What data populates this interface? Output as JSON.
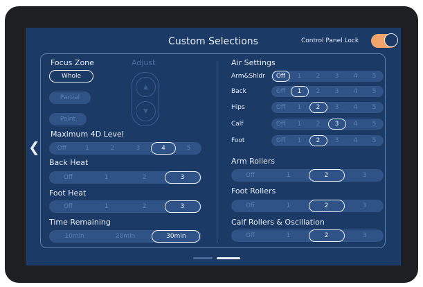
{
  "header": {
    "title": "Custom Selections",
    "lock_label": "Control Panel Lock",
    "lock_on": true
  },
  "nav": {
    "back_icon": "chevron-left-icon"
  },
  "focus_zone": {
    "label": "Focus Zone",
    "options": [
      "Whole",
      "Partial",
      "Point"
    ],
    "selected": "Whole"
  },
  "adjust": {
    "label": "Adjust",
    "up_icon": "chevron-up-icon",
    "down_icon": "chevron-down-icon"
  },
  "max_4d": {
    "label": "Maximum 4D Level",
    "options": [
      "Off",
      "1",
      "2",
      "3",
      "4",
      "5"
    ],
    "selected": "4"
  },
  "back_heat": {
    "label": "Back Heat",
    "options": [
      "Off",
      "1",
      "2",
      "3"
    ],
    "selected": "3"
  },
  "foot_heat": {
    "label": "Foot Heat",
    "options": [
      "Off",
      "1",
      "2",
      "3"
    ],
    "selected": "3"
  },
  "time_remaining": {
    "label": "Time Remaining",
    "options": [
      "10min",
      "20min",
      "30min"
    ],
    "selected": "30min"
  },
  "air_settings": {
    "label": "Air Settings",
    "rows": [
      {
        "label": "Arm&Shldr",
        "options": [
          "Off",
          "1",
          "2",
          "3",
          "4",
          "5"
        ],
        "selected": "Off"
      },
      {
        "label": "Back",
        "options": [
          "Off",
          "1",
          "2",
          "3",
          "4",
          "5"
        ],
        "selected": "1"
      },
      {
        "label": "Hips",
        "options": [
          "Off",
          "1",
          "2",
          "3",
          "4",
          "5"
        ],
        "selected": "2"
      },
      {
        "label": "Calf",
        "options": [
          "Off",
          "1",
          "2",
          "3",
          "4",
          "5"
        ],
        "selected": "3"
      },
      {
        "label": "Foot",
        "options": [
          "Off",
          "1",
          "2",
          "3",
          "4",
          "5"
        ],
        "selected": "2"
      }
    ]
  },
  "arm_rollers": {
    "label": "Arm Rollers",
    "options": [
      "Off",
      "1",
      "2",
      "3"
    ],
    "selected": "2"
  },
  "foot_rollers": {
    "label": "Foot Rollers",
    "options": [
      "Off",
      "1",
      "2",
      "3"
    ],
    "selected": "2"
  },
  "calf_rollers": {
    "label": "Calf Rollers & Oscillation",
    "options": [
      "Off",
      "1",
      "2",
      "3"
    ],
    "selected": "2"
  },
  "pager": {
    "pages": 2,
    "current": 2
  },
  "colors": {
    "background": "#1c3a66",
    "track": "#2f5287",
    "text": "#e6ecf5",
    "accent": "#f2a56a"
  }
}
